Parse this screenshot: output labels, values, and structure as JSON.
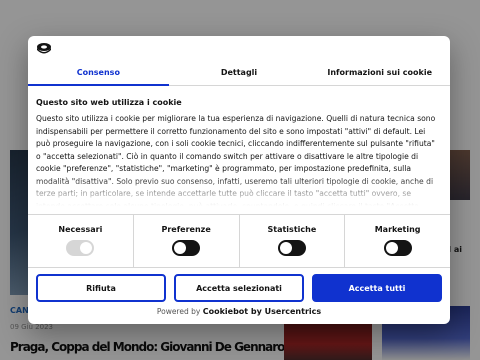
{
  "background": {
    "category": "CAN",
    "date": "09 Giu 2023",
    "headline": "Praga, Coppa del Mondo: Giovanni De Gennaro chiude terzo nel",
    "side_news": "ad ai"
  },
  "cookie_dialog": {
    "brand_icon": "cookiebot-logo-icon",
    "tabs": [
      {
        "label": "Consenso",
        "active": true
      },
      {
        "label": "Dettagli",
        "active": false
      },
      {
        "label": "Informazioni sui cookie",
        "active": false
      }
    ],
    "title": "Questo sito web utilizza i cookie",
    "text": "Questo sito utilizza i cookie per migliorare la tua esperienza di navigazione. Quelli di natura tecnica sono indispensabili per permettere il corretto funzionamento del sito e sono impostati \"attivi\" di default. Lei può proseguire la navigazione, con i soli cookie tecnici, cliccando indifferentemente sul pulsante \"rifiuta\" o \"accetta selezionati\". Ciò in quanto il comando switch per attivare o disattivare le altre tipologie di cookie \"preferenze\", \"statistiche\", \"marketing\" è programmato, per impostazione predefinita, sulla modalità \"disattiva\". Solo previo suo consenso, infatti, useremo tali ulteriori tipologie di cookie, anche di terze parti; in particolare, se intende accettarle tutte può cliccare il tasto \"accetta tutti\" ovvero, se intende accettare solo alcune tipologie, può attivarle, spuntandole, e quindi cliccare il tasto \"Accetta selezionati\". Tutto",
    "toggles": [
      {
        "label": "Necessari",
        "on": true,
        "disabled": true
      },
      {
        "label": "Preferenze",
        "on": false,
        "disabled": false
      },
      {
        "label": "Statistiche",
        "on": false,
        "disabled": false
      },
      {
        "label": "Marketing",
        "on": false,
        "disabled": false
      }
    ],
    "buttons": {
      "reject": "Rifiuta",
      "accept_selected": "Accetta selezionati",
      "accept_all": "Accetta tutti"
    },
    "powered_by_prefix": "Powered by",
    "powered_by_brand": "Cookiebot by Usercentrics",
    "accent_color": "#1032cf"
  }
}
